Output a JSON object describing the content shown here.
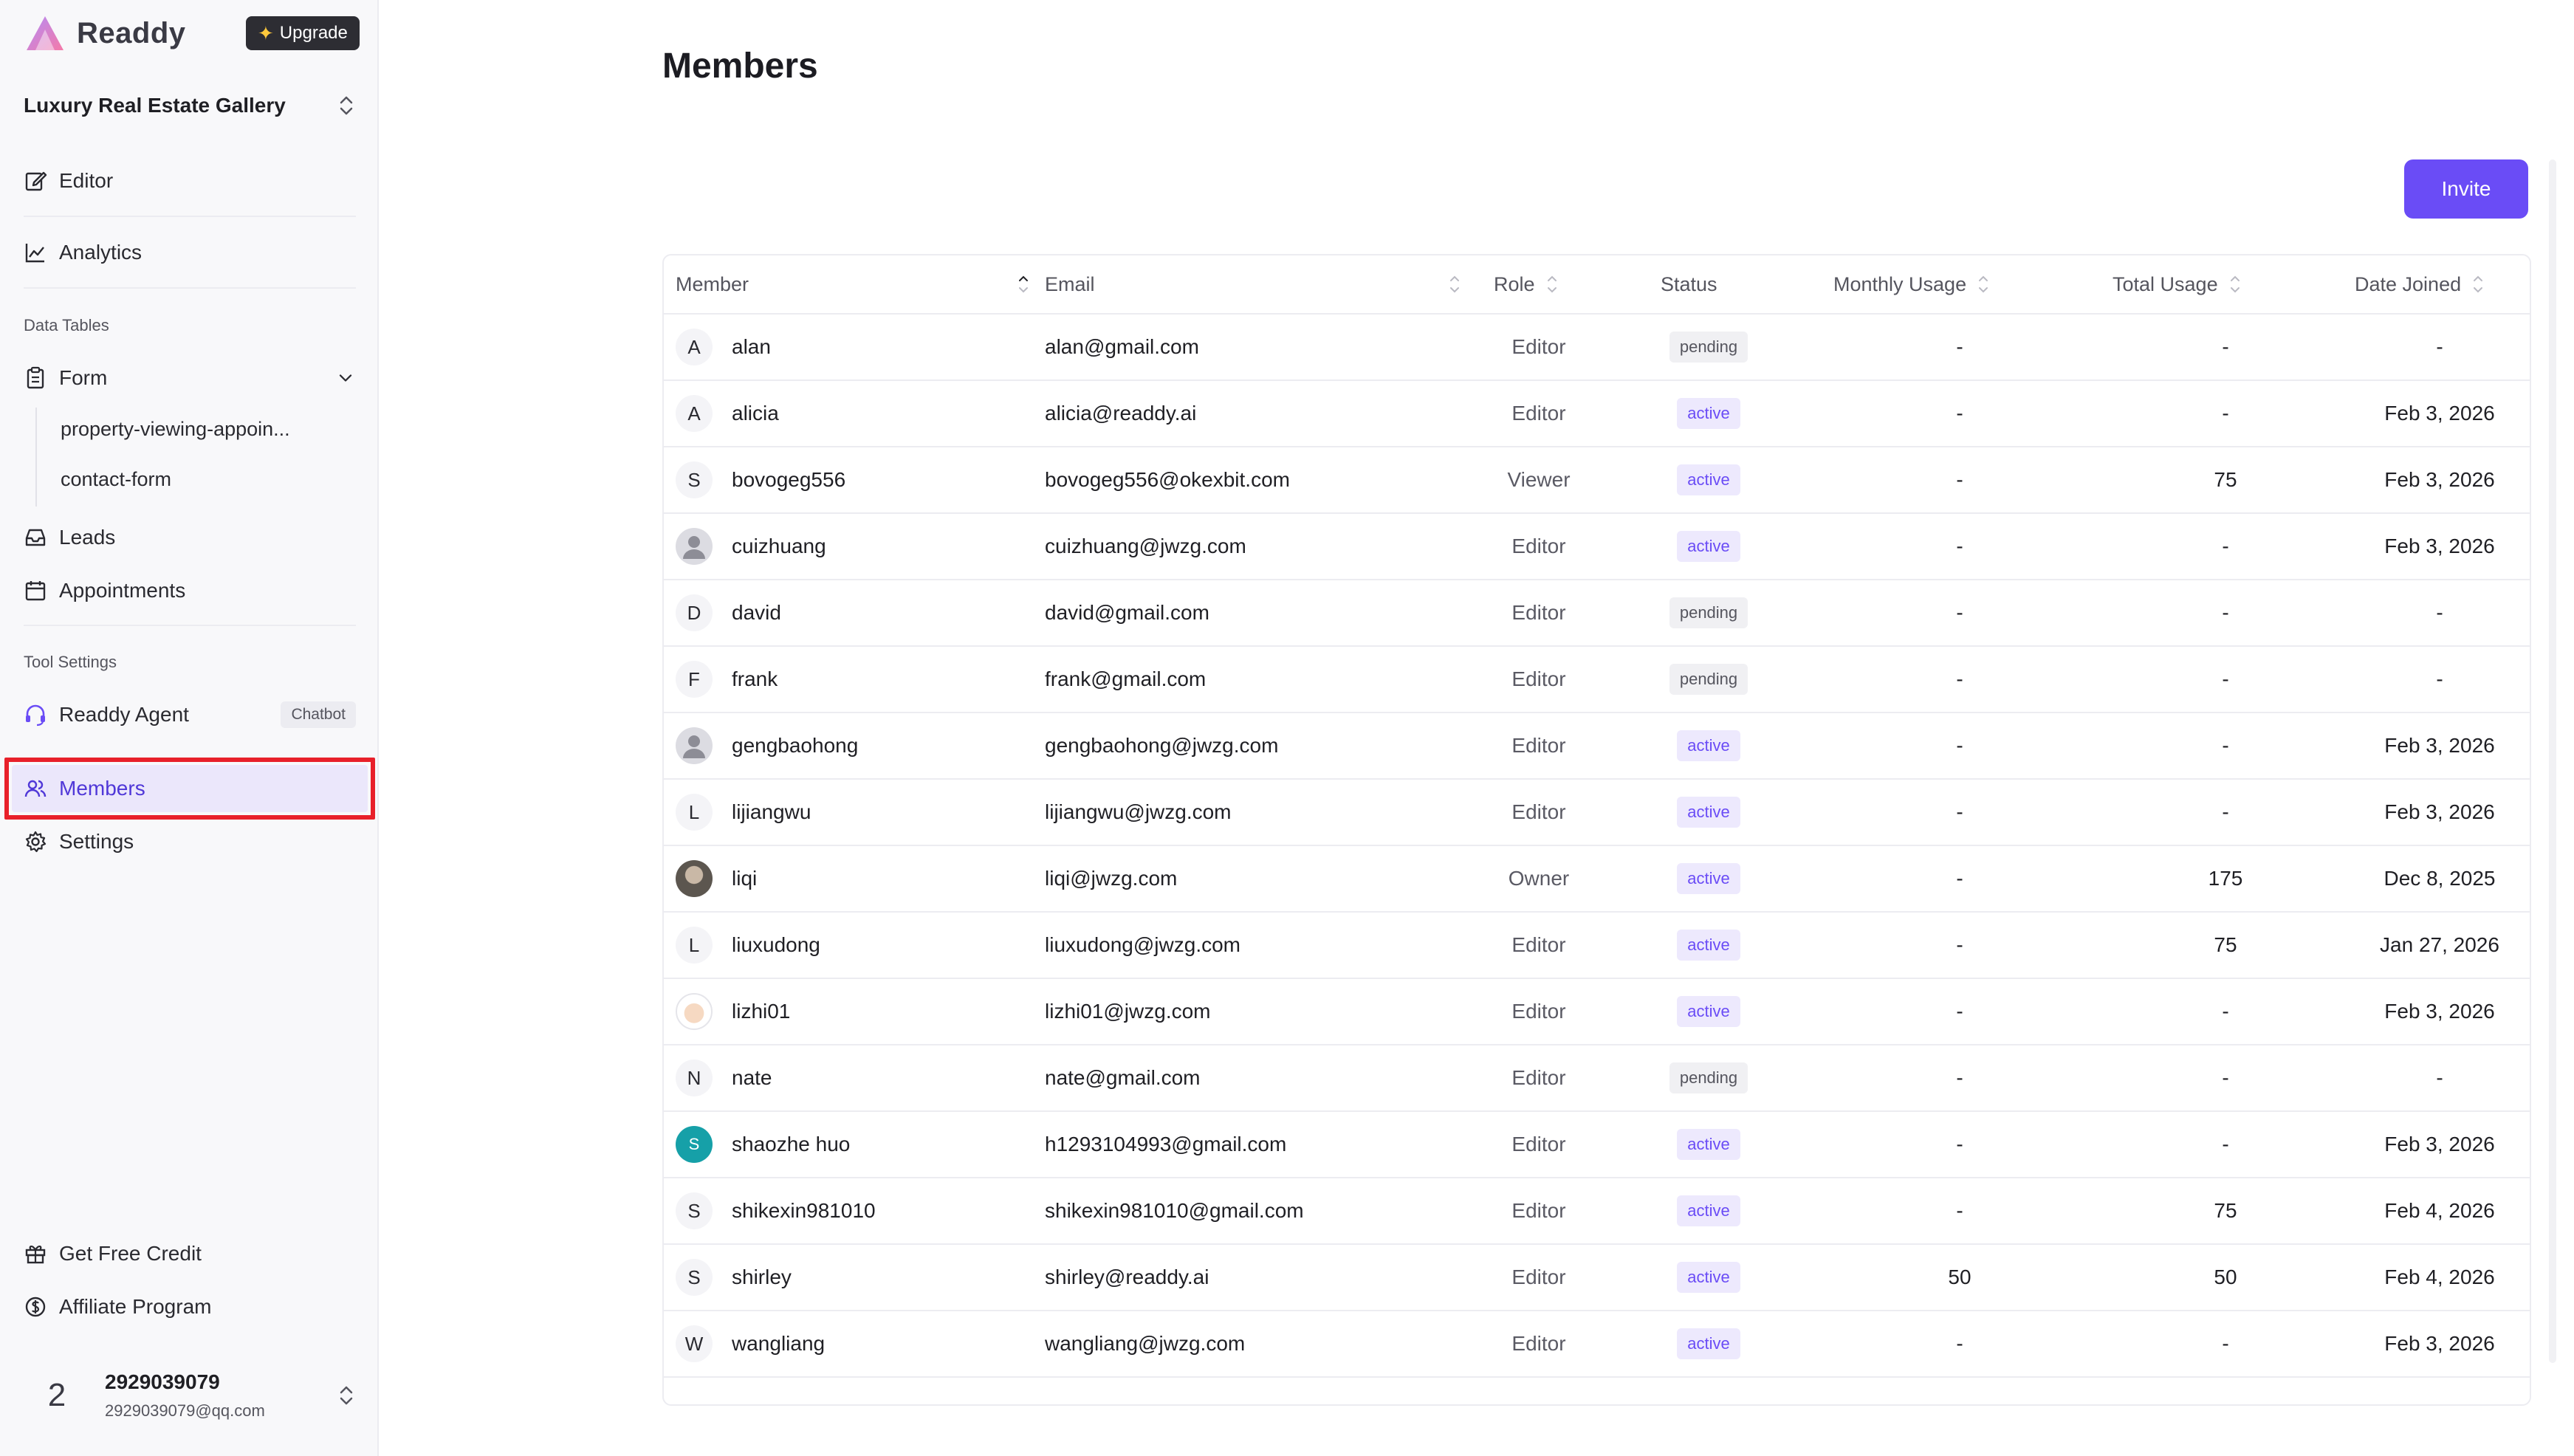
{
  "brand": {
    "name": "Readdy",
    "upgrade_label": "Upgrade"
  },
  "workspace": {
    "name": "Luxury Real Estate Gallery"
  },
  "nav": {
    "editor": "Editor",
    "analytics": "Analytics",
    "data_tables_label": "Data Tables",
    "form": "Form",
    "form_children": [
      "property-viewing-appoin...",
      "contact-form"
    ],
    "leads": "Leads",
    "appointments": "Appointments",
    "tool_settings_label": "Tool Settings",
    "readdy_agent": "Readdy Agent",
    "chatbot_badge": "Chatbot",
    "members": "Members",
    "settings": "Settings",
    "get_free_credit": "Get Free Credit",
    "affiliate_program": "Affiliate Program"
  },
  "user": {
    "avatar_text": "2",
    "name": "2929039079",
    "email": "2929039079@qq.com"
  },
  "page": {
    "title": "Members",
    "invite_label": "Invite"
  },
  "table": {
    "columns": [
      "Member",
      "Email",
      "Role",
      "Status",
      "Monthly Usage",
      "Total Usage",
      "Date Joined"
    ],
    "rows": [
      {
        "avatar": "A",
        "avatar_type": "letter",
        "member": "alan",
        "email": "alan@gmail.com",
        "role": "Editor",
        "status": "pending",
        "monthly": "-",
        "total": "-",
        "joined": "-"
      },
      {
        "avatar": "A",
        "avatar_type": "letter",
        "member": "alicia",
        "email": "alicia@readdy.ai",
        "role": "Editor",
        "status": "active",
        "monthly": "-",
        "total": "-",
        "joined": "Feb 3, 2026"
      },
      {
        "avatar": "S",
        "avatar_type": "letter",
        "member": "bovogeg556",
        "email": "bovogeg556@okexbit.com",
        "role": "Viewer",
        "status": "active",
        "monthly": "-",
        "total": "75",
        "joined": "Feb 3, 2026"
      },
      {
        "avatar": "",
        "avatar_type": "gray",
        "member": "cuizhuang",
        "email": "cuizhuang@jwzg.com",
        "role": "Editor",
        "status": "active",
        "monthly": "-",
        "total": "-",
        "joined": "Feb 3, 2026"
      },
      {
        "avatar": "D",
        "avatar_type": "letter",
        "member": "david",
        "email": "david@gmail.com",
        "role": "Editor",
        "status": "pending",
        "monthly": "-",
        "total": "-",
        "joined": "-"
      },
      {
        "avatar": "F",
        "avatar_type": "letter",
        "member": "frank",
        "email": "frank@gmail.com",
        "role": "Editor",
        "status": "pending",
        "monthly": "-",
        "total": "-",
        "joined": "-"
      },
      {
        "avatar": "",
        "avatar_type": "gray",
        "member": "gengbaohong",
        "email": "gengbaohong@jwzg.com",
        "role": "Editor",
        "status": "active",
        "monthly": "-",
        "total": "-",
        "joined": "Feb 3, 2026"
      },
      {
        "avatar": "L",
        "avatar_type": "letter",
        "member": "lijiangwu",
        "email": "lijiangwu@jwzg.com",
        "role": "Editor",
        "status": "active",
        "monthly": "-",
        "total": "-",
        "joined": "Feb 3, 2026"
      },
      {
        "avatar": "",
        "avatar_type": "photo",
        "member": "liqi",
        "email": "liqi@jwzg.com",
        "role": "Owner",
        "status": "active",
        "monthly": "-",
        "total": "175",
        "joined": "Dec 8, 2025"
      },
      {
        "avatar": "L",
        "avatar_type": "letter",
        "member": "liuxudong",
        "email": "liuxudong@jwzg.com",
        "role": "Editor",
        "status": "active",
        "monthly": "-",
        "total": "75",
        "joined": "Jan 27, 2026"
      },
      {
        "avatar": "",
        "avatar_type": "cartoon",
        "member": "lizhi01",
        "email": "lizhi01@jwzg.com",
        "role": "Editor",
        "status": "active",
        "monthly": "-",
        "total": "-",
        "joined": "Feb 3, 2026"
      },
      {
        "avatar": "N",
        "avatar_type": "letter",
        "member": "nate",
        "email": "nate@gmail.com",
        "role": "Editor",
        "status": "pending",
        "monthly": "-",
        "total": "-",
        "joined": "-"
      },
      {
        "avatar": "S",
        "avatar_type": "teal",
        "member": "shaozhe huo",
        "email": "h1293104993@gmail.com",
        "role": "Editor",
        "status": "active",
        "monthly": "-",
        "total": "-",
        "joined": "Feb 3, 2026"
      },
      {
        "avatar": "S",
        "avatar_type": "letter",
        "member": "shikexin981010",
        "email": "shikexin981010@gmail.com",
        "role": "Editor",
        "status": "active",
        "monthly": "-",
        "total": "75",
        "joined": "Feb 4, 2026"
      },
      {
        "avatar": "S",
        "avatar_type": "letter",
        "member": "shirley",
        "email": "shirley@readdy.ai",
        "role": "Editor",
        "status": "active",
        "monthly": "50",
        "total": "50",
        "joined": "Feb 4, 2026"
      },
      {
        "avatar": "W",
        "avatar_type": "letter",
        "member": "wangliang",
        "email": "wangliang@jwzg.com",
        "role": "Editor",
        "status": "active",
        "monthly": "-",
        "total": "-",
        "joined": "Feb 3, 2026"
      }
    ]
  },
  "colors": {
    "accent": "#6a4cf6",
    "highlight": "#e8202a",
    "active_bg": "#ede9fd"
  }
}
